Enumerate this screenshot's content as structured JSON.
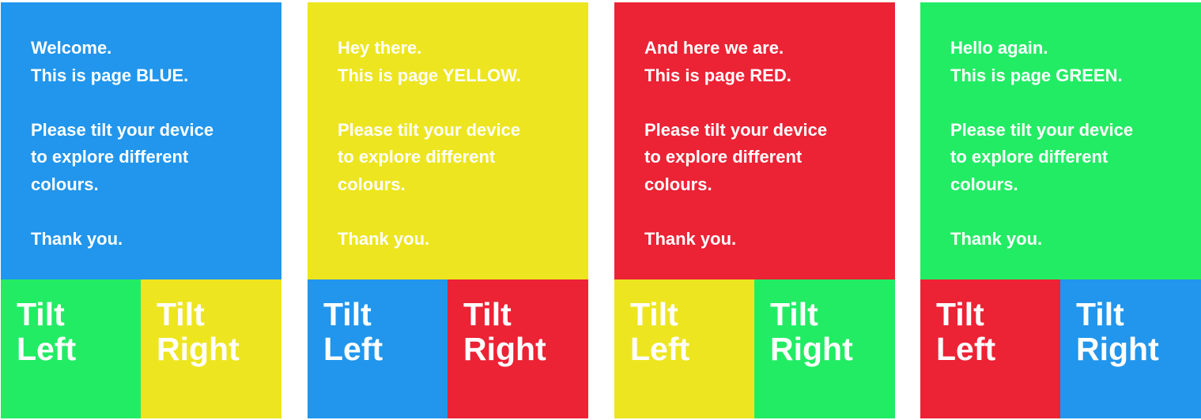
{
  "colors": {
    "blue": "#2196EC",
    "yellow": "#EDE520",
    "red": "#EC2235",
    "green": "#22EC64"
  },
  "screens": [
    {
      "bg": "#2196EC",
      "greeting": "Welcome.",
      "page_line": "This is page BLUE.",
      "instruction_1": "Please tilt your device",
      "instruction_2": "to explore different",
      "instruction_3": "colours.",
      "thanks": "Thank you.",
      "left_bg": "#22EC64",
      "right_bg": "#EDE520",
      "left_word1": "Tilt",
      "left_word2": "Left",
      "right_word1": "Tilt",
      "right_word2": "Right"
    },
    {
      "bg": "#EDE520",
      "greeting": "Hey there.",
      "page_line": "This is page YELLOW.",
      "instruction_1": "Please tilt your device",
      "instruction_2": "to explore different",
      "instruction_3": "colours.",
      "thanks": "Thank you.",
      "left_bg": "#2196EC",
      "right_bg": "#EC2235",
      "left_word1": "Tilt",
      "left_word2": "Left",
      "right_word1": "Tilt",
      "right_word2": "Right"
    },
    {
      "bg": "#EC2235",
      "greeting": "And here we are.",
      "page_line": "This is page RED.",
      "instruction_1": "Please tilt your device",
      "instruction_2": "to explore different",
      "instruction_3": "colours.",
      "thanks": "Thank you.",
      "left_bg": "#EDE520",
      "right_bg": "#22EC64",
      "left_word1": "Tilt",
      "left_word2": "Left",
      "right_word1": "Tilt",
      "right_word2": "Right"
    },
    {
      "bg": "#22EC64",
      "greeting": "Hello again.",
      "page_line": "This is page GREEN.",
      "instruction_1": "Please tilt your device",
      "instruction_2": "to explore different",
      "instruction_3": "colours.",
      "thanks": "Thank you.",
      "left_bg": "#EC2235",
      "right_bg": "#2196EC",
      "left_word1": "Tilt",
      "left_word2": "Left",
      "right_word1": "Tilt",
      "right_word2": "Right"
    }
  ]
}
